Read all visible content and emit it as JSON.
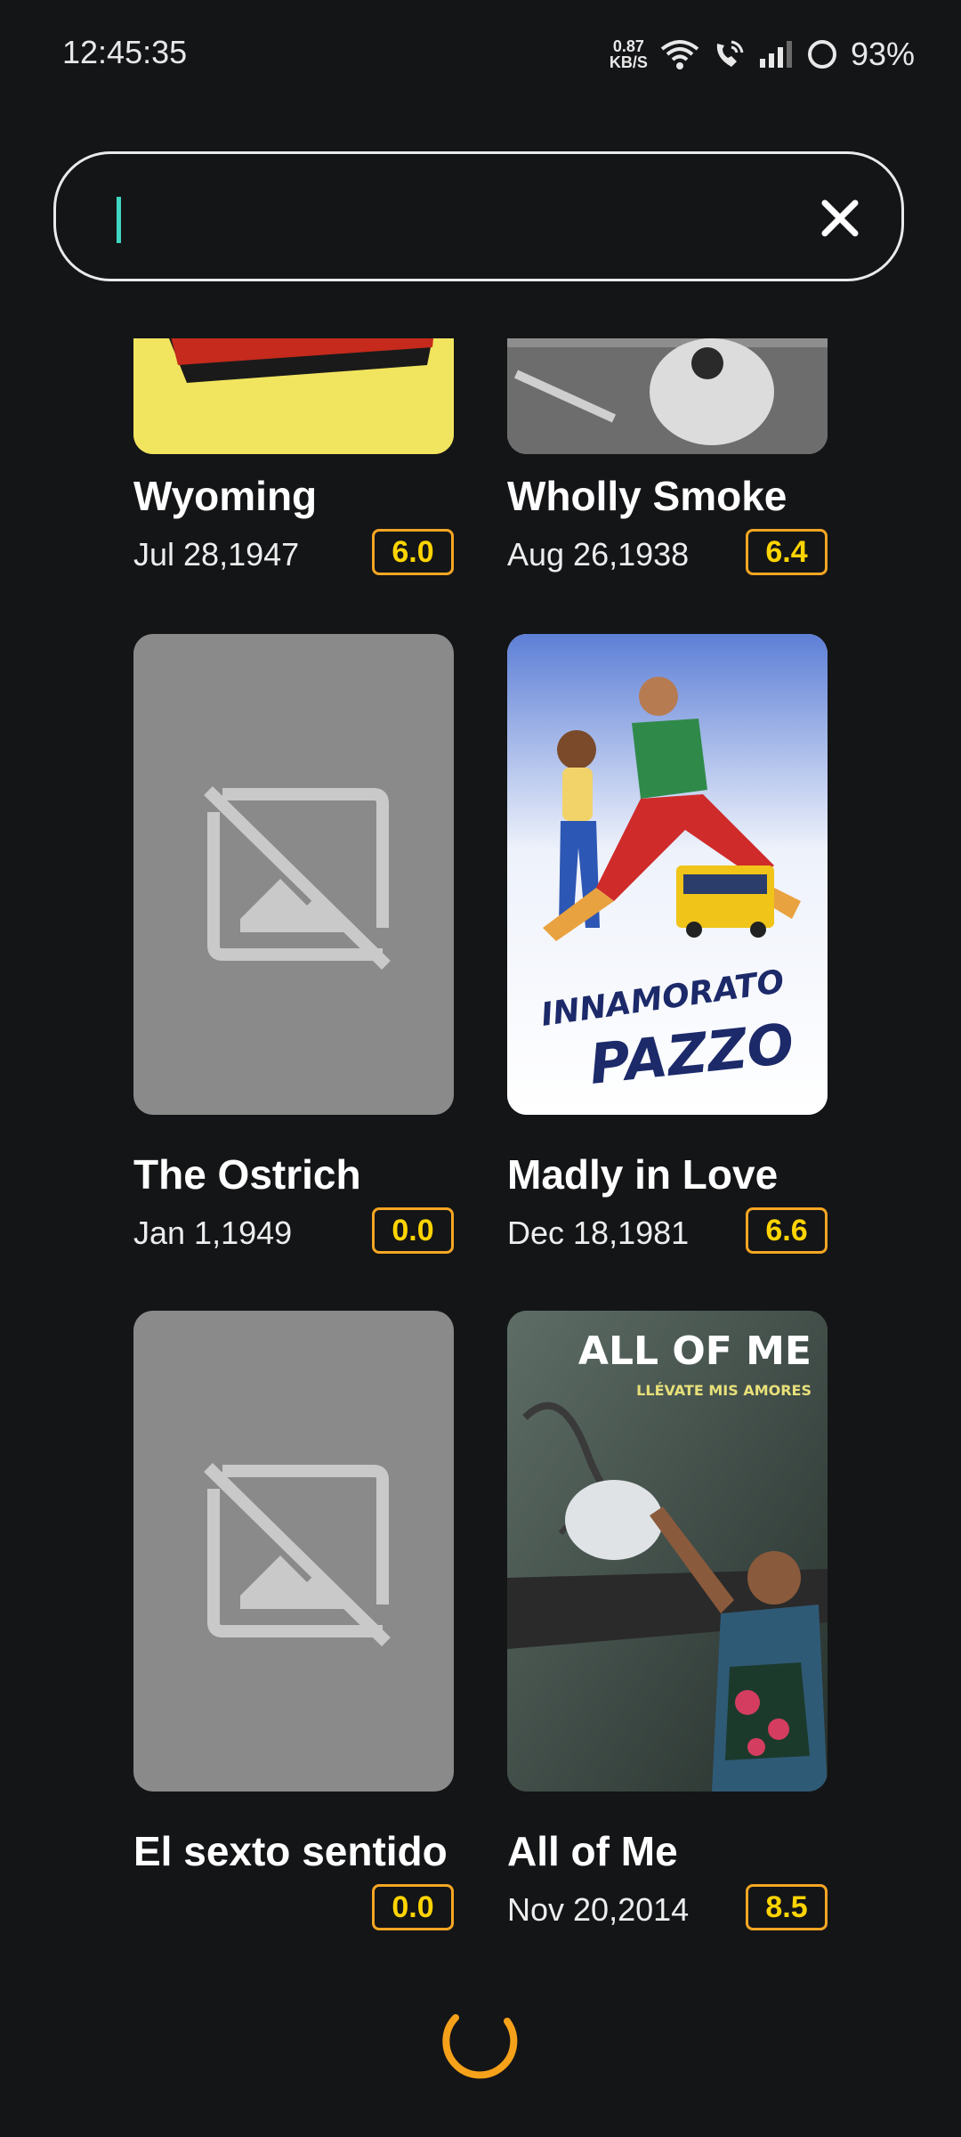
{
  "status_bar": {
    "time": "12:45:35",
    "net_speed_value": "0.87",
    "net_speed_unit": "KB/S",
    "battery": "93%",
    "icons": [
      "wifi-icon",
      "wifi-call-icon",
      "signal-icon",
      "battery-ring-icon"
    ]
  },
  "search": {
    "value": "",
    "placeholder": "",
    "clear_icon": "close-icon"
  },
  "colors": {
    "background": "#141517",
    "rating_border": "#f5a623",
    "rating_text": "#ffd400",
    "caret": "#3fd6c2",
    "spinner": "#f5a11a"
  },
  "movies": [
    {
      "title": "Wyoming",
      "date": "Jul 28,1947",
      "rating": "6.0"
    },
    {
      "title": "Wholly Smoke",
      "date": "Aug 26,1938",
      "rating": "6.4"
    },
    {
      "title": "The Ostrich",
      "date": "Jan 1,1949",
      "rating": "0.0",
      "poster": "no-image-icon"
    },
    {
      "title": "Madly in Love",
      "date": "Dec 18,1981",
      "rating": "6.6",
      "poster_text": [
        "INNAMORATO",
        "PAZZO"
      ]
    },
    {
      "title": "El sexto sentido",
      "date": "",
      "rating": "0.0",
      "poster": "no-image-icon"
    },
    {
      "title": "All of Me",
      "date": "Nov 20,2014",
      "rating": "8.5",
      "poster_text": [
        "ALL OF ME",
        "LLÉVATE MIS AMORES"
      ]
    }
  ],
  "loading_icon": "loading-spinner-icon"
}
